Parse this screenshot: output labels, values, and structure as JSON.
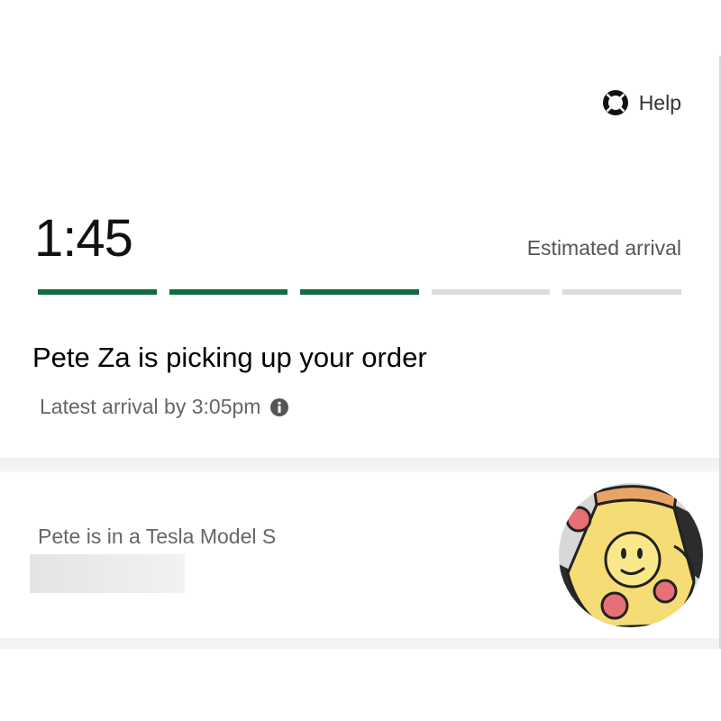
{
  "header": {
    "help_label": "Help"
  },
  "eta": {
    "time": "1:45",
    "label": "Estimated arrival"
  },
  "progress": {
    "total_steps": 5,
    "completed_steps": 3,
    "active_color": "#136b3c",
    "inactive_color": "#dcdcdc"
  },
  "status": {
    "message": "Pete Za is picking up your order",
    "latest_arrival": "Latest arrival by 3:05pm"
  },
  "driver": {
    "vehicle": "Pete is in a Tesla Model S"
  },
  "icons": {
    "help": "lifebuoy-icon",
    "info": "info-icon",
    "avatar": "pizza-slice-avatar"
  }
}
